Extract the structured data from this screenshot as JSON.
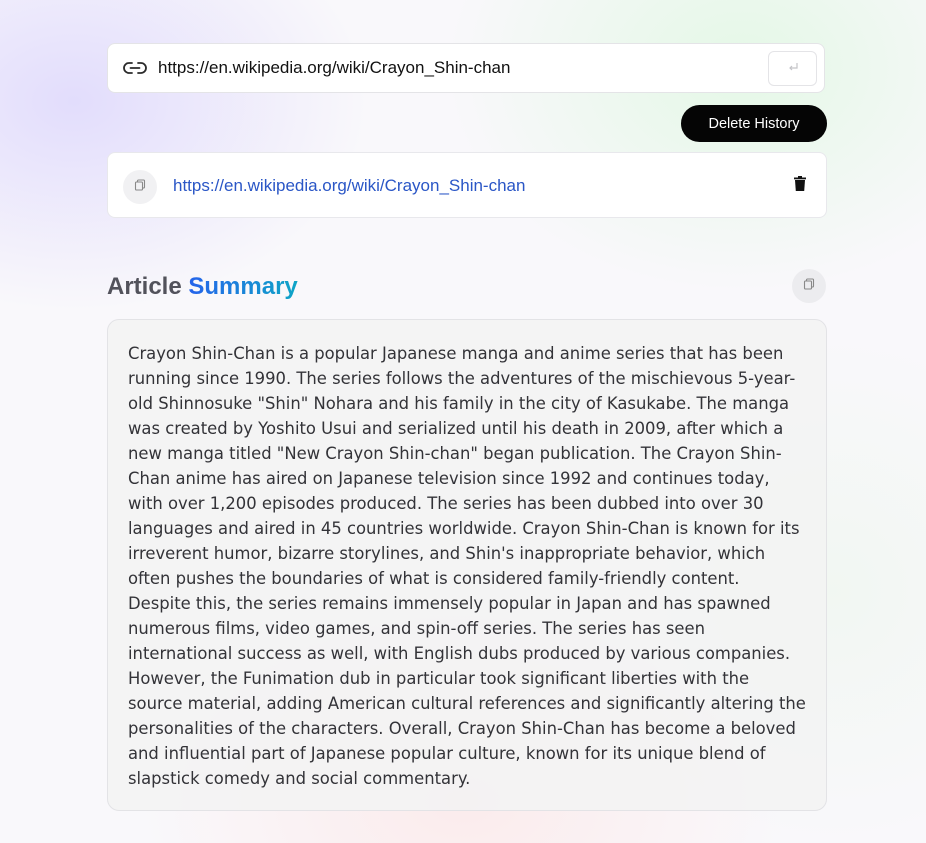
{
  "url_input": {
    "value": "https://en.wikipedia.org/wiki/Crayon_Shin-chan",
    "icon": "link-icon",
    "submit_icon": "enter-icon"
  },
  "actions": {
    "delete_history_label": "Delete History"
  },
  "history": [
    {
      "url": "https://en.wikipedia.org/wiki/Crayon_Shin-chan",
      "copy_icon": "copy-icon",
      "delete_icon": "trash-icon"
    }
  ],
  "summary": {
    "heading_prefix": "Article",
    "heading_accent": "Summary",
    "copy_icon": "copy-icon",
    "text": "Crayon Shin-Chan is a popular Japanese manga and anime series that has been running since 1990. The series follows the adventures of the mischievous 5-year-old Shinnosuke \"Shin\" Nohara and his family in the city of Kasukabe. The manga was created by Yoshito Usui and serialized until his death in 2009, after which a new manga titled \"New Crayon Shin-chan\" began publication. The Crayon Shin-Chan anime has aired on Japanese television since 1992 and continues today, with over 1,200 episodes produced. The series has been dubbed into over 30 languages and aired in 45 countries worldwide. Crayon Shin-Chan is known for its irreverent humor, bizarre storylines, and Shin's inappropriate behavior, which often pushes the boundaries of what is considered family-friendly content. Despite this, the series remains immensely popular in Japan and has spawned numerous films, video games, and spin-off series. The series has seen international success as well, with English dubs produced by various companies. However, the Funimation dub in particular took significant liberties with the source material, adding American cultural references and significantly altering the personalities of the characters. Overall, Crayon Shin-Chan has become a beloved and influential part of Japanese popular culture, known for its unique blend of slapstick comedy and social commentary."
  },
  "colors": {
    "link": "#2a56c6",
    "accent_start": "#2563eb",
    "accent_end": "#0ea5c6",
    "button_dark": "#050505"
  }
}
